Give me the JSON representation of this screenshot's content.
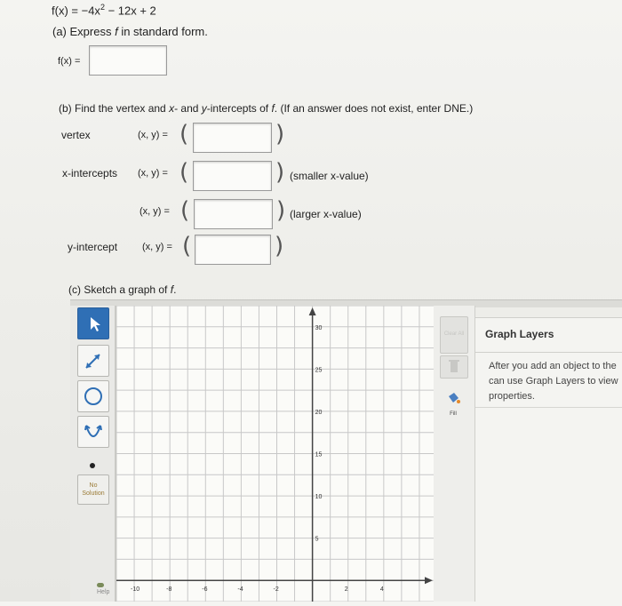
{
  "problem": {
    "function_label": "f(x)",
    "function_expr": "= −4x",
    "function_exp": "2",
    "function_rest": " − 12x + 2"
  },
  "part_a": {
    "prompt_prefix": "(a) Express ",
    "prompt_var": "f",
    "prompt_suffix": " in standard form.",
    "answer_label": "f(x) =",
    "answer_value": ""
  },
  "part_b": {
    "prompt_prefix": "(b) Find the vertex and ",
    "prompt_x": "x",
    "prompt_mid": "- and ",
    "prompt_y": "y",
    "prompt_mid2": "-intercepts of ",
    "prompt_f": "f",
    "prompt_suffix": ". (If an answer does not exist, enter DNE.)",
    "vertex_label": "vertex",
    "x_intercepts_label": "x-intercepts",
    "y_intercept_label": "y-intercept",
    "coord_label": "(x, y) =",
    "smaller_note": "(smaller x-value)",
    "larger_note": "(larger x-value)",
    "vertex_value": "",
    "x_int_small_value": "",
    "x_int_large_value": "",
    "y_int_value": ""
  },
  "part_c": {
    "prompt_prefix": "(c) Sketch a graph of ",
    "prompt_f": "f",
    "prompt_suffix": "."
  },
  "graph_tool": {
    "no_solution_label": "No Solution",
    "help_label": "Help",
    "clear_label": "Clear All",
    "fill_label": "Fill",
    "y_ticks": [
      "30",
      "25",
      "20",
      "15",
      "10",
      "5"
    ],
    "x_ticks": [
      "-10",
      "-8",
      "-6",
      "-4",
      "-2",
      "2",
      "4"
    ]
  },
  "graph_layers": {
    "title": "Graph Layers",
    "line1": "After you add an object to the",
    "line2": "can use Graph Layers to view",
    "line3": "properties."
  },
  "colors": {
    "accent_blue": "#2f6fb5",
    "grid_line": "#c8c8c8",
    "axis": "#444444"
  }
}
